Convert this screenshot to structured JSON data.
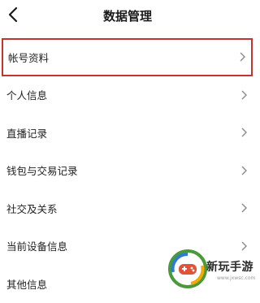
{
  "header": {
    "title": "数据管理",
    "back_icon": "chevron-left-icon"
  },
  "items": [
    {
      "label": "帐号资料",
      "highlighted": true
    },
    {
      "label": "个人信息"
    },
    {
      "label": "直播记录"
    },
    {
      "label": "钱包与交易记录"
    },
    {
      "label": "社交及关系"
    },
    {
      "label": "当前设备信息"
    },
    {
      "label": "其他信息"
    }
  ],
  "watermark": {
    "text": "新玩手游",
    "url": "www.jxwsc.com"
  },
  "colors": {
    "highlight_border": "#c0352f",
    "chevron": "#8a8a8a"
  }
}
